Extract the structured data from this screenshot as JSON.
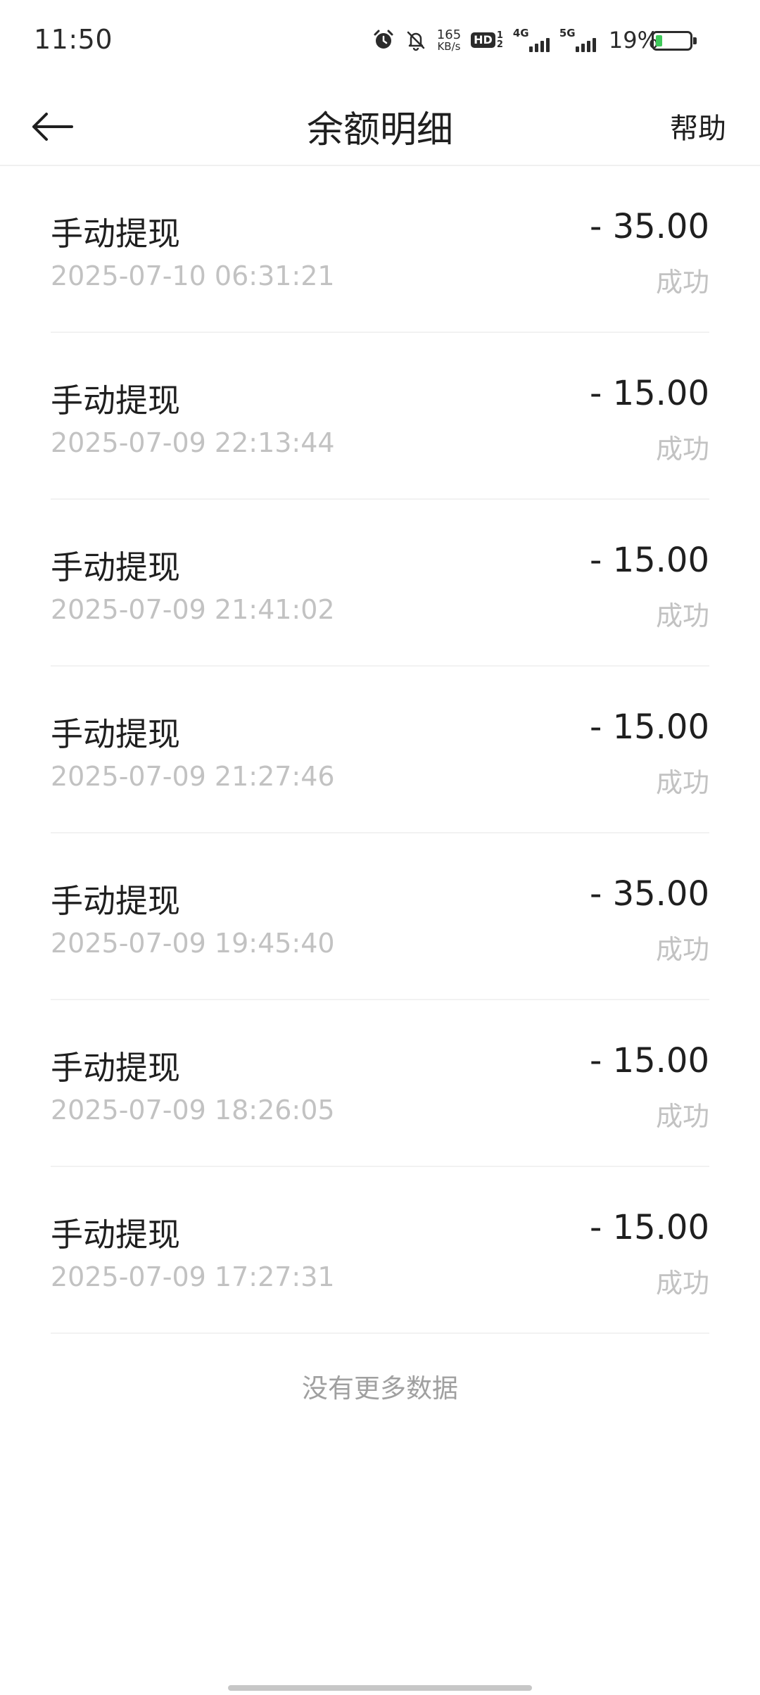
{
  "status_bar": {
    "time": "11:50",
    "net_speed_value": "165",
    "net_speed_unit": "KB/s",
    "hd_label": "HD",
    "hd_sub_top": "1",
    "hd_sub_bottom": "2",
    "signal_1_tag": "4G",
    "signal_2_tag": "5G",
    "battery_percent": "19%",
    "battery_level": 0.19,
    "battery_color": "#3fc95a"
  },
  "nav": {
    "title": "余额明细",
    "help_label": "帮助"
  },
  "records": [
    {
      "title": "手动提现",
      "time": "2025-07-10 06:31:21",
      "amount": "- 35.00",
      "status": "成功"
    },
    {
      "title": "手动提现",
      "time": "2025-07-09 22:13:44",
      "amount": "- 15.00",
      "status": "成功"
    },
    {
      "title": "手动提现",
      "time": "2025-07-09 21:41:02",
      "amount": "- 15.00",
      "status": "成功"
    },
    {
      "title": "手动提现",
      "time": "2025-07-09 21:27:46",
      "amount": "- 15.00",
      "status": "成功"
    },
    {
      "title": "手动提现",
      "time": "2025-07-09 19:45:40",
      "amount": "- 35.00",
      "status": "成功"
    },
    {
      "title": "手动提现",
      "time": "2025-07-09 18:26:05",
      "amount": "- 15.00",
      "status": "成功"
    },
    {
      "title": "手动提现",
      "time": "2025-07-09 17:27:31",
      "amount": "- 15.00",
      "status": "成功"
    }
  ],
  "footer": {
    "no_more_text": "没有更多数据"
  }
}
